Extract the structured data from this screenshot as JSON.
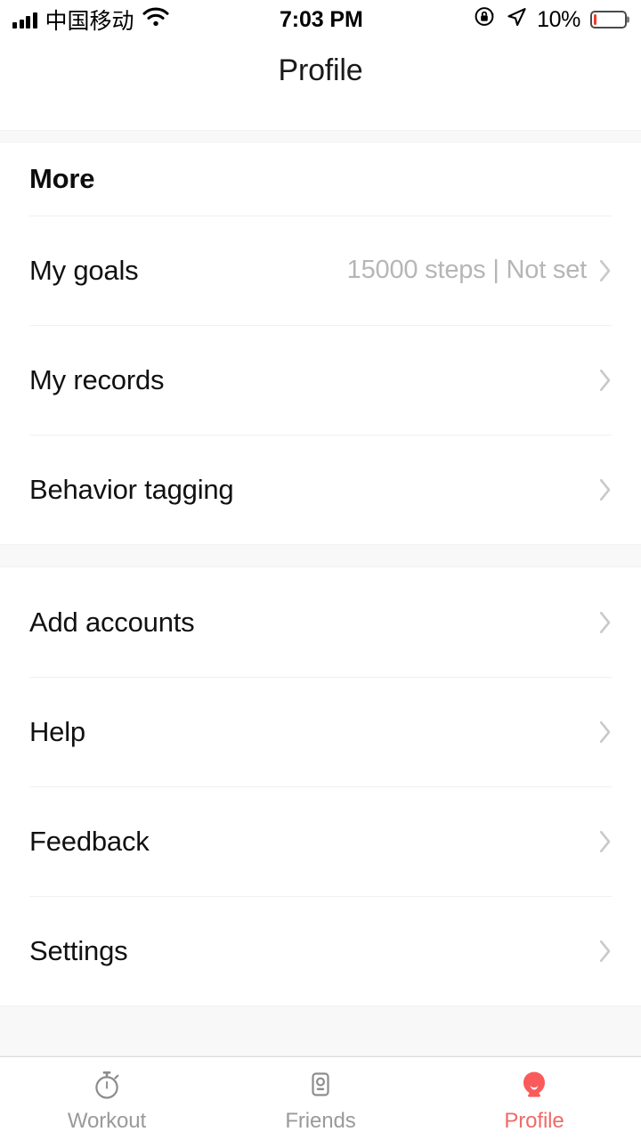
{
  "status_bar": {
    "carrier": "中国移动",
    "time": "7:03 PM",
    "battery_percent": "10%",
    "battery_level": 10,
    "icons": {
      "signal": "signal-bars-icon",
      "wifi": "wifi-icon",
      "rotation_lock": "rotation-lock-icon",
      "location": "location-arrow-icon",
      "battery": "battery-icon"
    }
  },
  "nav": {
    "title": "Profile"
  },
  "sections": [
    {
      "header": "More",
      "rows": [
        {
          "label": "My goals",
          "value": "15000 steps | Not set",
          "accessory": "chevron-right-icon"
        },
        {
          "label": "My records",
          "value": "",
          "accessory": "chevron-right-icon"
        },
        {
          "label": "Behavior tagging",
          "value": "",
          "accessory": "chevron-right-icon"
        }
      ]
    },
    {
      "header": "",
      "rows": [
        {
          "label": "Add accounts",
          "value": "",
          "accessory": "chevron-right-icon"
        },
        {
          "label": "Help",
          "value": "",
          "accessory": "chevron-right-icon"
        },
        {
          "label": "Feedback",
          "value": "",
          "accessory": "chevron-right-icon"
        },
        {
          "label": "Settings",
          "value": "",
          "accessory": "chevron-right-icon"
        }
      ]
    }
  ],
  "tab_bar": {
    "active": "Profile",
    "active_color": "#ef6b68",
    "inactive_color": "#9a9a9a",
    "tabs": [
      {
        "label": "Workout",
        "icon": "stopwatch-icon"
      },
      {
        "label": "Friends",
        "icon": "contact-card-icon"
      },
      {
        "label": "Profile",
        "icon": "person-filled-icon"
      }
    ]
  },
  "colors": {
    "accent": "#ef6b68",
    "profile_icon": "#fa5a5a",
    "battery_low": "#ef3b2d",
    "text_primary": "#111111",
    "text_muted": "#b6b6b6",
    "divider": "#f0f0f0",
    "section_gap": "#f8f8f8"
  }
}
